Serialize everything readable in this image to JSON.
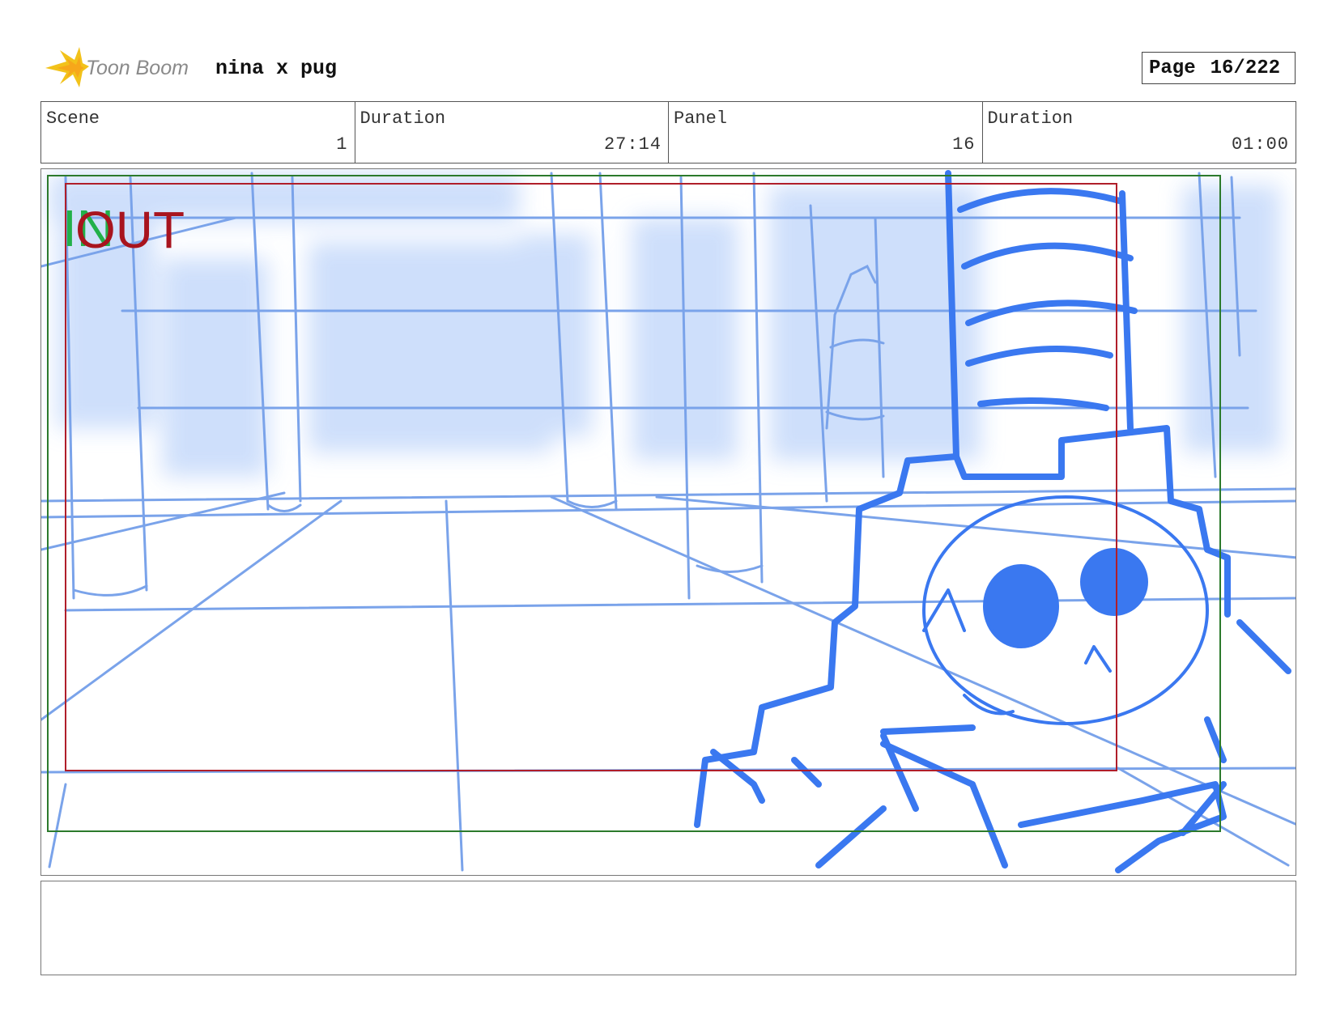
{
  "header": {
    "logo_text": "Toon Boom",
    "project_title": "nina x pug",
    "page_label": "Page",
    "page_value": "16/222"
  },
  "info": {
    "scene_label": "Scene",
    "scene_value": "1",
    "scene_duration_label": "Duration",
    "scene_duration_value": "27:14",
    "panel_label": "Panel",
    "panel_value": "16",
    "panel_duration_label": "Duration",
    "panel_duration_value": "01:00"
  },
  "panel": {
    "in_marker": "IN",
    "out_marker": "OUT"
  },
  "notes": {
    "text": ""
  },
  "colors": {
    "sketch_blue": "#3a78f0",
    "light_blue": "#7aa3ea",
    "wash_blue": "#c9dcfb",
    "safe_frame_red": "#b01e2a",
    "title_safe_green": "#2c7a2c",
    "in_green": "#22b04a",
    "out_red": "#a8141e"
  }
}
